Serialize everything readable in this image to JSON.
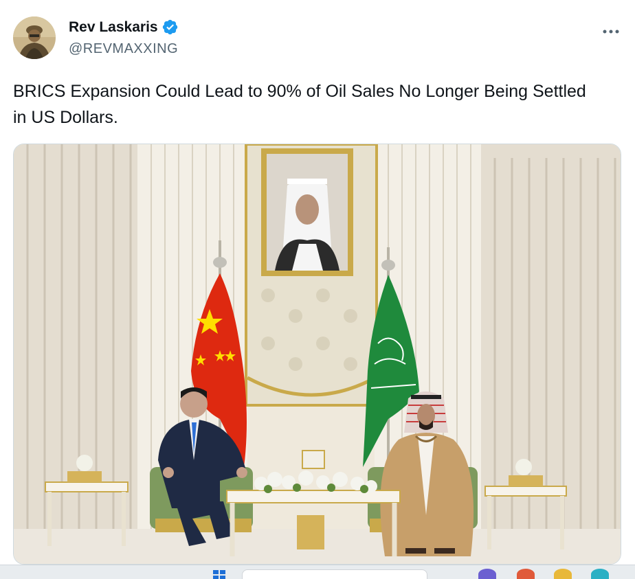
{
  "tweet": {
    "author": {
      "display_name": "Rev Laskaris",
      "handle": "@REVMAXXING",
      "verified": true,
      "avatar_icon": "soldier-avatar"
    },
    "more_icon": "more-horizontal-icon",
    "text": "BRICS Expansion Could Lead to 90% of Oil Sales No Longer Being Settled in US Dollars.",
    "media": {
      "description": "photo-meeting-room-with-two-flags"
    }
  },
  "colors": {
    "verified_blue": "#1d9bf0",
    "text_primary": "#0f1419",
    "text_secondary": "#536471",
    "china_flag_red": "#de2910",
    "saudi_flag_green": "#1f8a3c"
  },
  "taskbar": {
    "icons": [
      "windows-start-icon",
      "search-box",
      "app-icon",
      "app-icon",
      "app-icon",
      "app-icon"
    ]
  }
}
